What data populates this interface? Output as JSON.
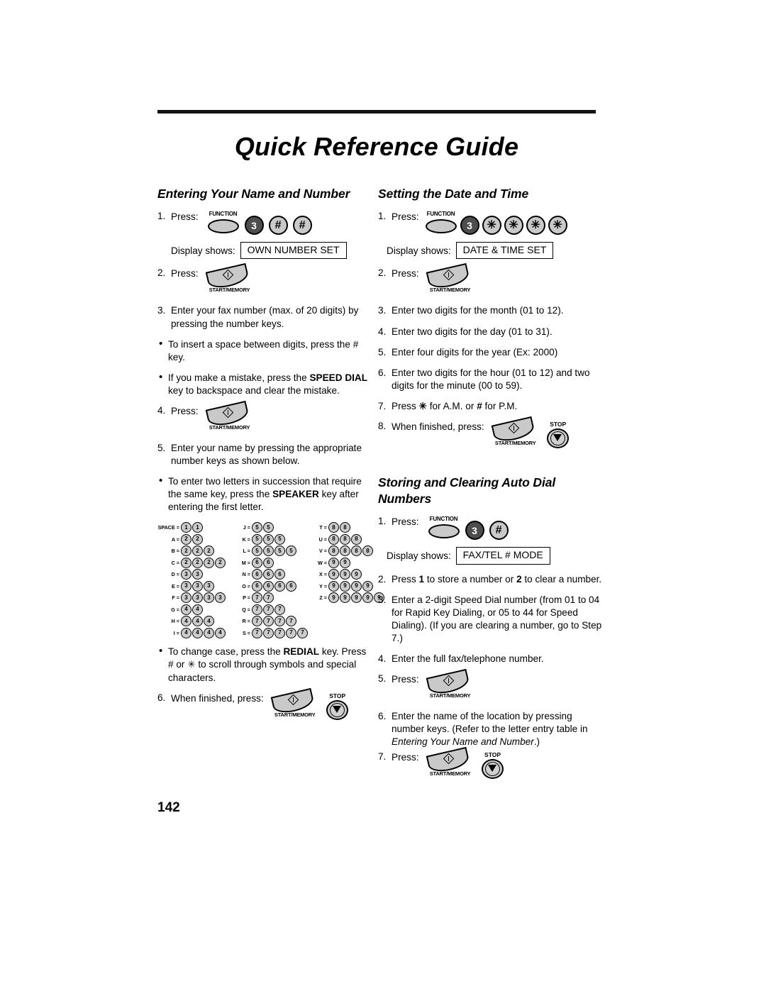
{
  "document": {
    "title": "Quick Reference Guide",
    "page_number": "142"
  },
  "sections": {
    "entering_name": {
      "heading": "Entering Your Name and Number",
      "step1_num": "1.",
      "step1_label": "Press:",
      "step1_keys": [
        "FUNCTION",
        "3",
        "#",
        "#"
      ],
      "display_label": "Display shows:",
      "display_value": "OWN NUMBER SET",
      "step2_num": "2.",
      "step2_label": "Press:",
      "step2_key": "START/MEMORY",
      "step3_num": "3.",
      "step3_text": "Enter your fax number (max. of 20 digits) by pressing the number keys.",
      "bullet1_a": "To insert  a space between digits, press the # key.",
      "bullet2_a": "If you make a mistake, press the ",
      "bullet2_b": "SPEED DIAL",
      "bullet2_c": " key to backspace and clear the mistake.",
      "step4_num": "4.",
      "step4_label": "Press:",
      "step4_key": "START/MEMORY",
      "step5_num": "5.",
      "step5_text": "Enter your name by pressing the appropriate number keys as shown below.",
      "bullet3_a": "To enter two letters in succession that require the same key, press the ",
      "bullet3_b": "SPEAKER",
      "bullet3_c": " key after entering the first letter.",
      "bullet4_a": "To change case, press the ",
      "bullet4_b": "REDIAL",
      "bullet4_c": " key. Press # or ✳ to scroll through symbols and special characters.",
      "step6_num": "6.",
      "step6_label": "When finished, press:",
      "step6_keys": [
        "START/MEMORY",
        "STOP"
      ]
    },
    "date_time": {
      "heading": "Setting the Date and Time",
      "step1_num": "1.",
      "step1_label": "Press:",
      "step1_keys": [
        "FUNCTION",
        "3",
        "✳",
        "✳",
        "✳",
        "✳"
      ],
      "display_label": "Display shows:",
      "display_value": "DATE & TIME SET",
      "step2_num": "2.",
      "step2_label": "Press:",
      "step2_key": "START/MEMORY",
      "step3_num": "3.",
      "step3_text": "Enter two digits for the month (01 to 12).",
      "step4_num": "4.",
      "step4_text": "Enter two digits for the day (01 to 31).",
      "step5_num": "5.",
      "step5_text": "Enter four digits for the year (Ex: 2000)",
      "step6_num": "6.",
      "step6_text": "Enter two digits for the hour (01 to 12) and two digits for the minute (00 to 59).",
      "step7_num": "7.",
      "step7_text_a": "Press ",
      "step7_text_b": "✳",
      "step7_text_c": " for A.M. or ",
      "step7_text_d": "#",
      "step7_text_e": " for P.M.",
      "step8_num": "8.",
      "step8_label": "When finished, press:",
      "step8_keys": [
        "START/MEMORY",
        "STOP"
      ]
    },
    "auto_dial": {
      "heading": "Storing and Clearing Auto Dial Numbers",
      "step1_num": "1.",
      "step1_label": "Press:",
      "step1_keys": [
        "FUNCTION",
        "3",
        "#"
      ],
      "display_label": "Display shows:",
      "display_value": "FAX/TEL # MODE",
      "step2_num": "2.",
      "step2_text_a": "Press ",
      "step2_text_b": "1",
      "step2_text_c": " to store a number or ",
      "step2_text_d": "2",
      "step2_text_e": " to clear a number.",
      "step3_num": "3.",
      "step3_text": "Enter a 2-digit Speed Dial number (from 01 to 04 for Rapid Key Dialing, or 05 to 44 for Speed Dialing). (If you are clearing a number, go to Step 7.)",
      "step4_num": "4.",
      "step4_text": "Enter the full fax/telephone number.",
      "step5_num": "5.",
      "step5_label": "Press:",
      "step5_key": "START/MEMORY",
      "step6_num": "6.",
      "step6_text_a": "Enter the name of the location by pressing number keys. (Refer to the letter entry table in ",
      "step6_text_b": "Entering Your Name and Number",
      "step6_text_c": ".)",
      "step7_num": "7.",
      "step7_label": "Press:",
      "step7_keys": [
        "START/MEMORY",
        "STOP"
      ]
    }
  },
  "letter_table": {
    "columns": [
      [
        {
          "label": "SPACE =",
          "key": "1",
          "count": 2
        },
        {
          "label": "A =",
          "key": "2",
          "count": 2
        },
        {
          "label": "B =",
          "key": "2",
          "count": 3
        },
        {
          "label": "C =",
          "key": "2",
          "count": 4
        },
        {
          "label": "D =",
          "key": "3",
          "count": 2
        },
        {
          "label": "E =",
          "key": "3",
          "count": 3
        },
        {
          "label": "F =",
          "key": "3",
          "count": 4
        },
        {
          "label": "G =",
          "key": "4",
          "count": 2
        },
        {
          "label": "H =",
          "key": "4",
          "count": 3
        },
        {
          "label": "I =",
          "key": "4",
          "count": 4
        }
      ],
      [
        {
          "label": "J =",
          "key": "5",
          "count": 2
        },
        {
          "label": "K =",
          "key": "5",
          "count": 3
        },
        {
          "label": "L =",
          "key": "5",
          "count": 4
        },
        {
          "label": "M =",
          "key": "6",
          "count": 2
        },
        {
          "label": "N =",
          "key": "6",
          "count": 3
        },
        {
          "label": "O =",
          "key": "6",
          "count": 4
        },
        {
          "label": "P =",
          "key": "7",
          "count": 2
        },
        {
          "label": "Q =",
          "key": "7",
          "count": 3
        },
        {
          "label": "R =",
          "key": "7",
          "count": 4
        },
        {
          "label": "S =",
          "key": "7",
          "count": 5
        }
      ],
      [
        {
          "label": "T =",
          "key": "8",
          "count": 2
        },
        {
          "label": "U =",
          "key": "8",
          "count": 3
        },
        {
          "label": "V =",
          "key": "8",
          "count": 4
        },
        {
          "label": "W =",
          "key": "9",
          "count": 2
        },
        {
          "label": "X =",
          "key": "9",
          "count": 3
        },
        {
          "label": "Y =",
          "key": "9",
          "count": 4
        },
        {
          "label": "Z =",
          "key": "9",
          "count": 5
        }
      ]
    ]
  },
  "colors": {
    "key_light": "#c9c9c9",
    "key_dark": "#4d4d4d",
    "ink": "#000000",
    "paper": "#ffffff"
  }
}
